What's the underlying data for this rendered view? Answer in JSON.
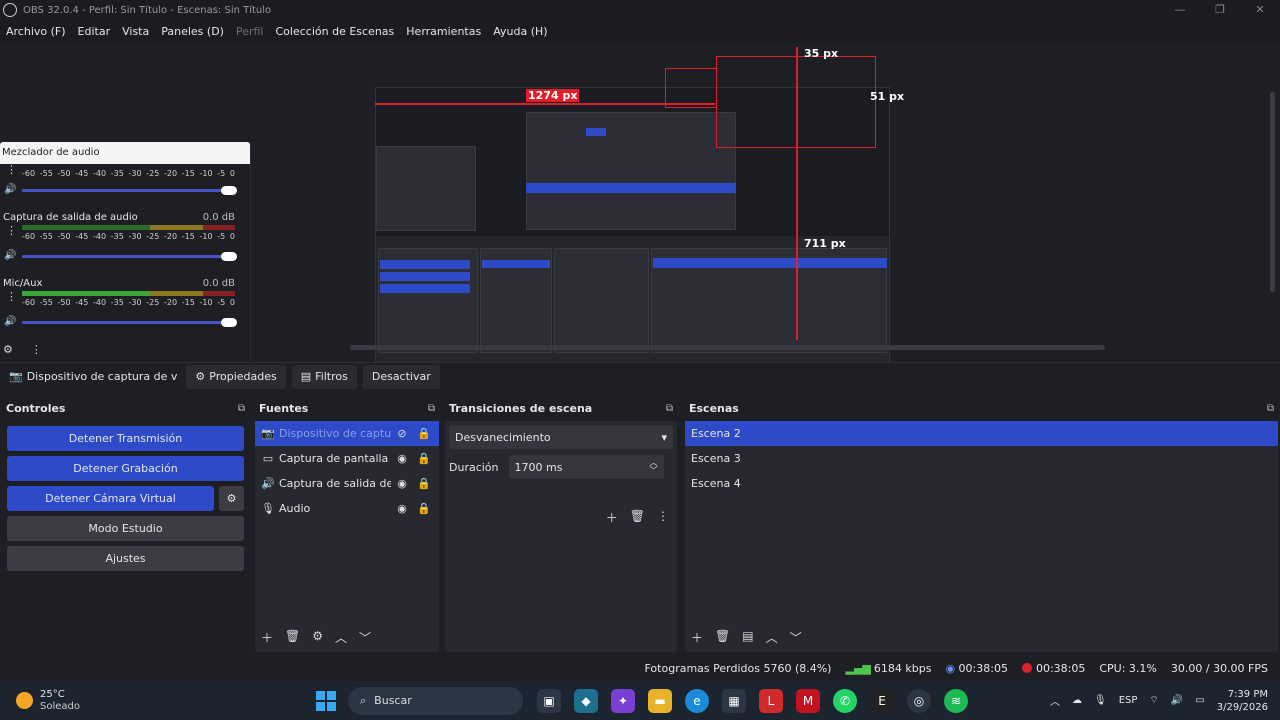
{
  "window": {
    "title": "OBS 32.0.4 - Perfil: Sin Título - Escenas: Sin Título",
    "controls": [
      "—",
      "❐",
      "✕"
    ]
  },
  "menu": [
    "Archivo (F)",
    "Editar",
    "Vista",
    "Paneles (D)",
    "Perfil",
    "Colección de Escenas",
    "Herramientas",
    "Ayuda (H)"
  ],
  "preview": {
    "measurements": {
      "w": "1274 px",
      "top": "35 px",
      "side": "51 px",
      "h": "711 px"
    }
  },
  "mixer": {
    "title": "Mezclador de audio",
    "ticks": [
      "-60",
      "-55",
      "-50",
      "-45",
      "-40",
      "-35",
      "-30",
      "-25",
      "-20",
      "-15",
      "-10",
      "-5",
      "0"
    ],
    "channels": [
      {
        "name": "",
        "db": ""
      },
      {
        "name": "Captura de salida de audio",
        "db": "0.0 dB"
      },
      {
        "name": "Mic/Aux",
        "db": "0.0 dB"
      }
    ]
  },
  "source_toolbar": {
    "source": "Dispositivo de captura de v",
    "properties": "Propiedades",
    "filters": "Filtros",
    "deactivate": "Desactivar"
  },
  "controls": {
    "title": "Controles",
    "buttons": [
      "Detener Transmisión",
      "Detener Grabación",
      "Detener Cámara Virtual",
      "Modo Estudio",
      "Ajustes"
    ]
  },
  "sources": {
    "title": "Fuentes",
    "items": [
      {
        "label": "Dispositivo de captura",
        "icon": "camera-icon"
      },
      {
        "label": "Captura de pantalla",
        "icon": "monitor-icon"
      },
      {
        "label": "Captura de salida de a",
        "icon": "speaker-icon"
      },
      {
        "label": "Audio",
        "icon": "mic-icon"
      }
    ]
  },
  "transitions": {
    "title": "Transiciones de escena",
    "selected": "Desvanecimiento",
    "duration_label": "Duración",
    "duration_value": "1700 ms"
  },
  "scenes": {
    "title": "Escenas",
    "items": [
      "Escena 2",
      "Escena 3",
      "Escena 4"
    ]
  },
  "status": {
    "dropped": "Fotogramas Perdidos 5760 (8.4%)",
    "bitrate": "6184 kbps",
    "stream_time": "00:38:05",
    "rec_time": "00:38:05",
    "cpu": "CPU: 3.1%",
    "fps": "30.00 / 30.00 FPS"
  },
  "taskbar": {
    "temp": "25°C",
    "weather": "Soleado",
    "search": "Buscar",
    "lang": "ESP",
    "time": "7:39 PM",
    "date": "3/29/2026"
  }
}
